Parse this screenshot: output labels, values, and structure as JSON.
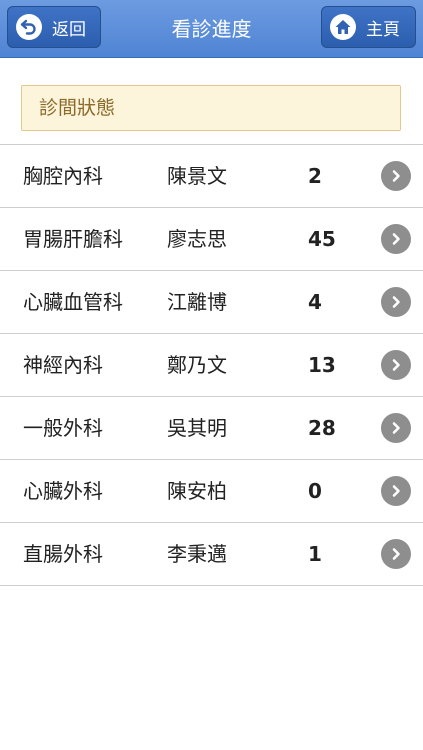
{
  "header": {
    "title": "看診進度",
    "back_label": "返回",
    "home_label": "主頁"
  },
  "status": {
    "label": "診間狀態"
  },
  "rows": [
    {
      "dept": "胸腔內科",
      "doctor": "陳景文",
      "count": "2"
    },
    {
      "dept": "胃腸肝膽科",
      "doctor": "廖志思",
      "count": "45"
    },
    {
      "dept": "心臟血管科",
      "doctor": "江離博",
      "count": "4"
    },
    {
      "dept": "神經內科",
      "doctor": "鄭乃文",
      "count": "13"
    },
    {
      "dept": "一般外科",
      "doctor": "吳其明",
      "count": "28"
    },
    {
      "dept": "心臟外科",
      "doctor": "陳安柏",
      "count": "0"
    },
    {
      "dept": "直腸外科",
      "doctor": "李秉邁",
      "count": "1"
    }
  ],
  "icons": {
    "back": "back-arrow-icon",
    "home": "home-icon",
    "row": "chevron-right-icon"
  },
  "colors": {
    "navbar": "#5b8ed8",
    "status_bg": "#fcf5dc",
    "status_text": "#8c6a2a",
    "chevron": "#8e8e8e"
  }
}
